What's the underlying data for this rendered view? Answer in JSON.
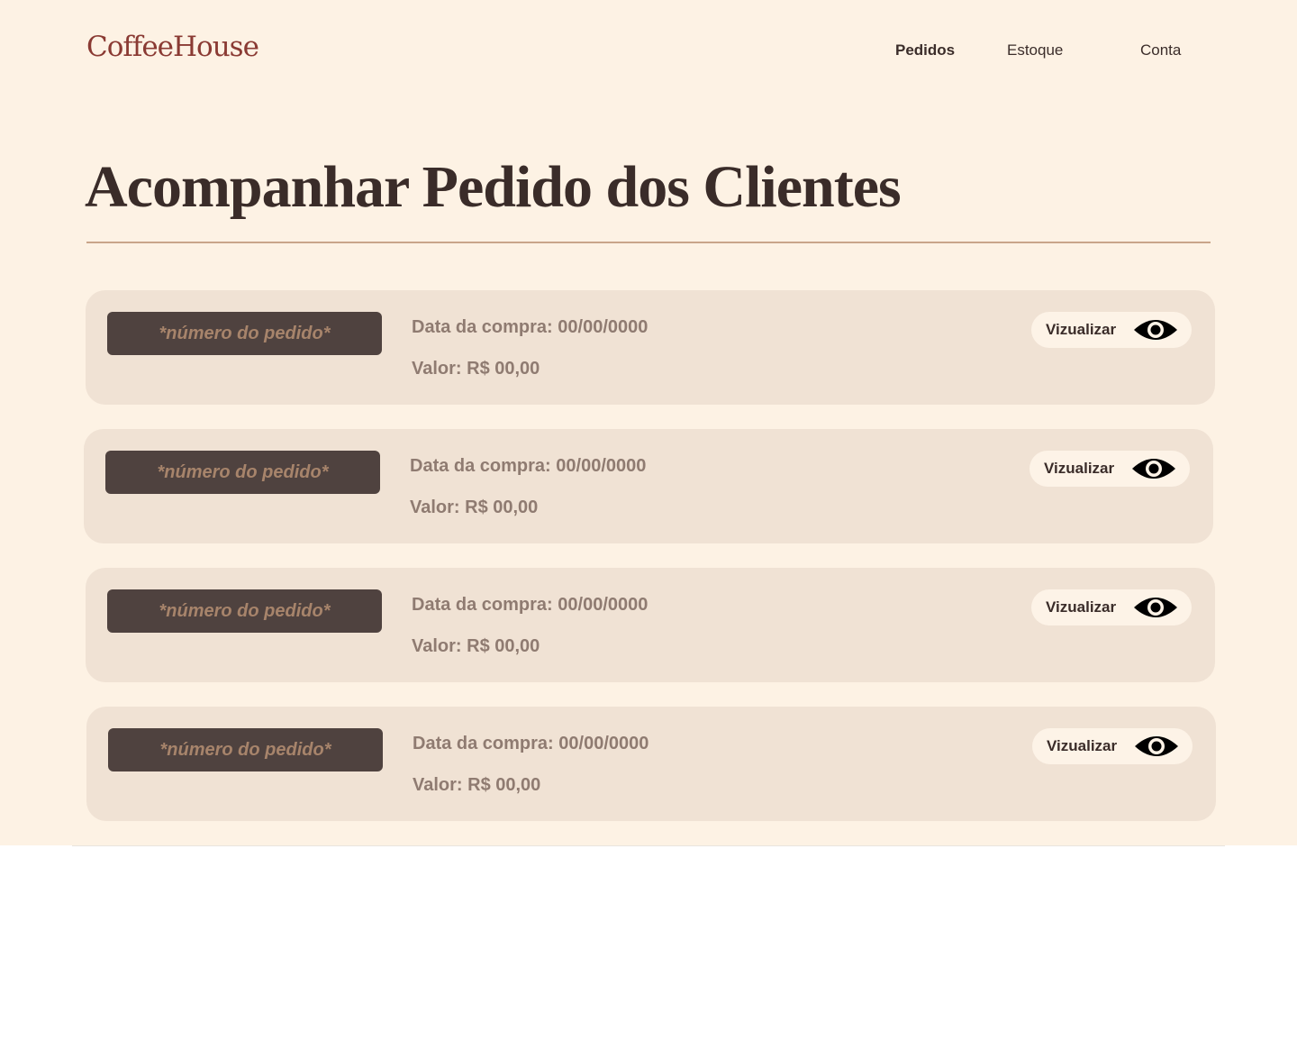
{
  "header": {
    "logo": "CoffeeHouse",
    "nav": [
      {
        "label": "Pedidos",
        "active": true
      },
      {
        "label": "Estoque",
        "active": false
      },
      {
        "label": "Conta",
        "active": false
      }
    ]
  },
  "main": {
    "title": "Acompanhar Pedido dos Clientes",
    "orders": [
      {
        "number": "*número do pedido*",
        "date": "Data da compra: 00/00/0000",
        "value": "Valor: R$ 00,00",
        "view_label": "Vizualizar",
        "icon": "eye-icon"
      },
      {
        "number": "*número do pedido*",
        "date": "Data da compra: 00/00/0000",
        "value": "Valor: R$ 00,00",
        "view_label": "Vizualizar",
        "icon": "eye-icon"
      },
      {
        "number": "*número do pedido*",
        "date": "Data da compra: 00/00/0000",
        "value": "Valor: R$ 00,00",
        "view_label": "Vizualizar",
        "icon": "eye-icon"
      },
      {
        "number": "*número do pedido*",
        "date": "Data da compra: 00/00/0000",
        "value": "Valor: R$ 00,00",
        "view_label": "Vizualizar",
        "icon": "eye-icon"
      }
    ]
  },
  "colors": {
    "background": "#fdf2e4",
    "card": "#f0e2d4",
    "logo": "#8a3a33",
    "order_badge": "#4f423f",
    "order_badge_text": "#a7846b",
    "muted_text": "#8f7b71",
    "divider": "#c9a58a"
  }
}
